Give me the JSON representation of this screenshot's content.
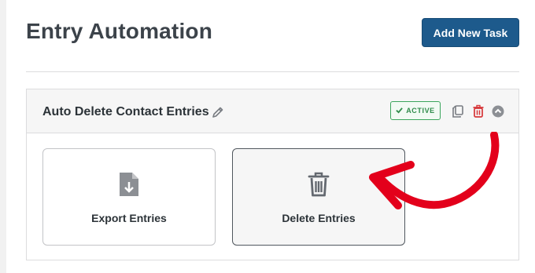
{
  "page": {
    "title": "Entry Automation",
    "add_button_label": "Add New Task"
  },
  "task": {
    "name": "Auto Delete Contact Entries",
    "status_label": "ACTIVE",
    "status_color": "#3ba55c",
    "icons": [
      "pencil-icon",
      "copy-icon",
      "trash-icon",
      "chevron-up-icon"
    ]
  },
  "actions": [
    {
      "label": "Export Entries",
      "icon": "file-download-icon",
      "selected": false
    },
    {
      "label": "Delete Entries",
      "icon": "trash-icon",
      "selected": true
    }
  ],
  "colors": {
    "primary_button": "#1d5a8c",
    "delete_red": "#d63638",
    "annotation_arrow": "#e3001b"
  },
  "annotation": {
    "type": "arrow",
    "points_to": "Delete Entries"
  }
}
